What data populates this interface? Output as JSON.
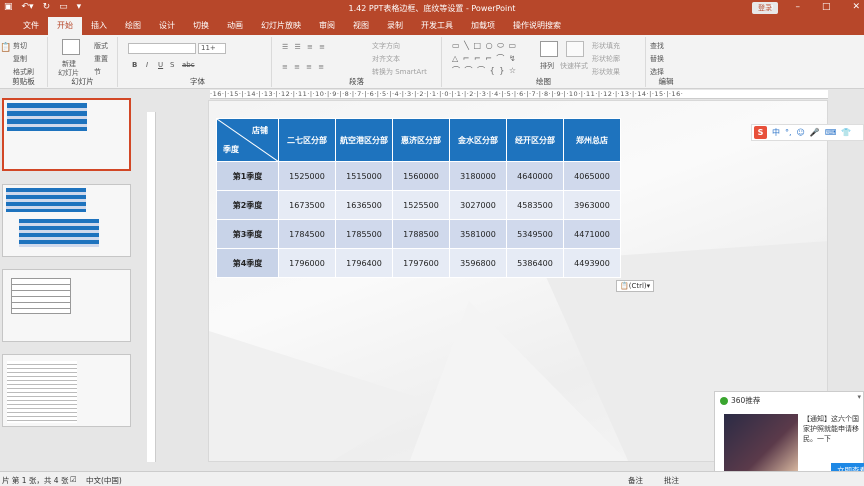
{
  "app": {
    "title": "1.42 PPT表格边框、底纹等设置 - PowerPoint",
    "login": "登录",
    "qa_icons": [
      "save-icon",
      "undo-icon",
      "redo-icon",
      "present-icon"
    ]
  },
  "tabs": [
    "文件",
    "开始",
    "插入",
    "绘图",
    "设计",
    "切换",
    "动画",
    "幻灯片放映",
    "审阅",
    "视图",
    "录制",
    "开发工具",
    "加载项",
    "操作说明搜索"
  ],
  "ribbon": {
    "clipboard": {
      "label": "剪贴板",
      "cut": "剪切",
      "copy": "复制",
      "format": "格式刷"
    },
    "slides": {
      "label": "幻灯片",
      "new": "新建",
      "new2": "幻灯片",
      "layout": "版式",
      "reset": "重置",
      "section": "节"
    },
    "font": {
      "label": "字体",
      "size": "11+",
      "bold": "B",
      "italic": "I",
      "underline": "U",
      "shadow": "S",
      "strike": "abc"
    },
    "paragraph": {
      "label": "段落",
      "direction": "文字方向",
      "align": "对齐文本",
      "smartart": "转换为 SmartArt"
    },
    "drawing": {
      "label": "绘图",
      "arrange": "排列",
      "quick": "快速样式",
      "fill": "形状填充",
      "outline": "形状轮廓",
      "effect": "形状效果"
    },
    "editing": {
      "label": "编辑",
      "find": "查找",
      "replace": "替换",
      "select": "选择"
    }
  },
  "ruler": "·16·|·15·|·14·|·13·|·12·|·11·|·10·|·9·|·8·|·7·|·6·|·5·|·4·|·3·|·2·|·1·|·0·|·1·|·2·|·3·|·4·|·5·|·6·|·7·|·8·|·9·|·10·|·11·|·12·|·13·|·14·|·15·|·16·",
  "thumbs": [
    "1",
    "2",
    "3",
    "4"
  ],
  "table": {
    "corner_top": "店铺",
    "corner_bottom": "季度",
    "headers": [
      "二七区分部",
      "航空港区分部",
      "惠济区分部",
      "金水区分部",
      "经开区分部",
      "郑州总店"
    ],
    "rows": [
      {
        "label": "第1季度",
        "values": [
          "1525000",
          "1515000",
          "1560000",
          "3180000",
          "4640000",
          "4065000"
        ]
      },
      {
        "label": "第2季度",
        "values": [
          "1673500",
          "1636500",
          "1525500",
          "3027000",
          "4583500",
          "3963000"
        ]
      },
      {
        "label": "第3季度",
        "values": [
          "1784500",
          "1785500",
          "1788500",
          "3581000",
          "5349500",
          "4471000"
        ]
      },
      {
        "label": "第4季度",
        "values": [
          "1796000",
          "1796400",
          "1797600",
          "3596800",
          "5386400",
          "4493900"
        ]
      }
    ]
  },
  "ctrl_label": "(Ctrl)▾",
  "ime": {
    "s": "S",
    "mode": "中"
  },
  "popup": {
    "title": "360推荐",
    "message": "【通知】这六个国家护照就能申请移民。一下",
    "button": "立即查看",
    "close": "▾"
  },
  "status": {
    "slide": "片 第 1 张，共 4 张",
    "lang": "中文(中国)",
    "notes": "备注",
    "comments": "批注"
  },
  "colors": {
    "brand": "#b7472a",
    "header": "#1e73be",
    "row_odd": "#d0d9ec",
    "row_even": "#e6ebf5"
  }
}
